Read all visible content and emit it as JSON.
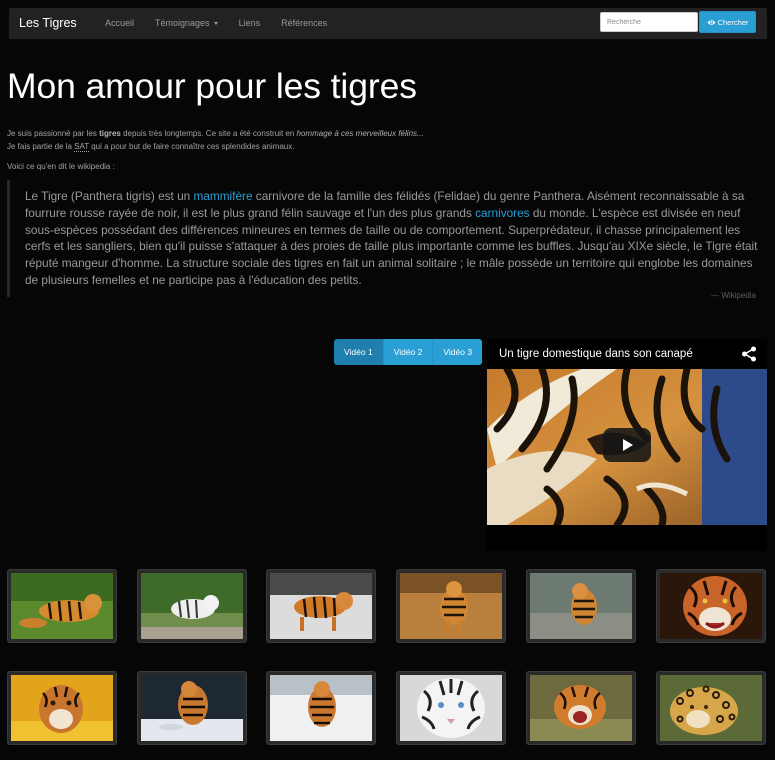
{
  "navbar": {
    "brand": "Les Tigres",
    "items": [
      {
        "label": "Accueil"
      },
      {
        "label": "Témoignages"
      },
      {
        "label": "Liens"
      },
      {
        "label": "Références"
      }
    ],
    "search_placeholder": "Recherche",
    "search_button": "Chercher",
    "search_icon": "eye-icon"
  },
  "title": "Mon amour pour les tigres",
  "intro": {
    "l1_a": "Je suis passionné par les ",
    "l1_b": "tigres",
    "l1_c": " depuis très longtemps. Ce site a été construit en ",
    "l1_d": "hommage à ces merveilleux félins...",
    "l2_a": "Je fais partie de la ",
    "l2_b": "SAT",
    "l2_c": " qui a pour but de faire connaître ces splendides animaux."
  },
  "wiki_intro": "Voici ce qu'en dit le wikipedia :",
  "quote": {
    "t1": "Le Tigre (Panthera tigris) est un ",
    "link1": "mammifère",
    "t2": " carnivore de la famille des félidés (Felidae) du genre Panthera. Aisément reconnaissable à sa fourrure rousse rayée de noir, il est le plus grand félin sauvage et l'un des plus grands ",
    "link2": "carnivores",
    "t3": " du monde. L'espèce est divisée en neuf sous-espèces possédant des différences mineures en termes de taille ou de comportement. Superprédateur, il chasse principalement les cerfs et les sangliers, bien qu'il puisse s'attaquer à des proies de taille plus importante comme les buffles. Jusqu'au XIXe siècle, le Tigre était réputé mangeur d'homme. La structure sociale des tigres en fait un animal solitaire ; le mâle possède un territoire qui englobe les domaines de plusieurs femelles et ne participe pas à l'éducation des petits.",
    "source": "— Wikipedia"
  },
  "video_tabs": [
    {
      "label": "Vidéo 1"
    },
    {
      "label": "Vidéo 2"
    },
    {
      "label": "Vidéo 3"
    }
  ],
  "video": {
    "title": "Un tigre domestique dans son canapé",
    "share_icon": "share-icon",
    "play_icon": "play-icon"
  },
  "colors": {
    "accent": "#2a9fd6",
    "navbar": "#222222",
    "background": "#060606"
  },
  "gallery": [
    {
      "icon": "tiger-photo-grass"
    },
    {
      "icon": "white-tiger-photo"
    },
    {
      "icon": "tiger-photo-snow"
    },
    {
      "icon": "tiger-photo-dry-grass"
    },
    {
      "icon": "tiger-photo-rocks"
    },
    {
      "icon": "tiger-face-photo"
    },
    {
      "icon": "tiger-cub-photo"
    },
    {
      "icon": "tiger-photo-snow-leap"
    },
    {
      "icon": "tiger-photo-snow-walk"
    },
    {
      "icon": "white-tiger-face-photo"
    },
    {
      "icon": "tiger-roaring-photo"
    },
    {
      "icon": "jaguar-photo"
    }
  ]
}
